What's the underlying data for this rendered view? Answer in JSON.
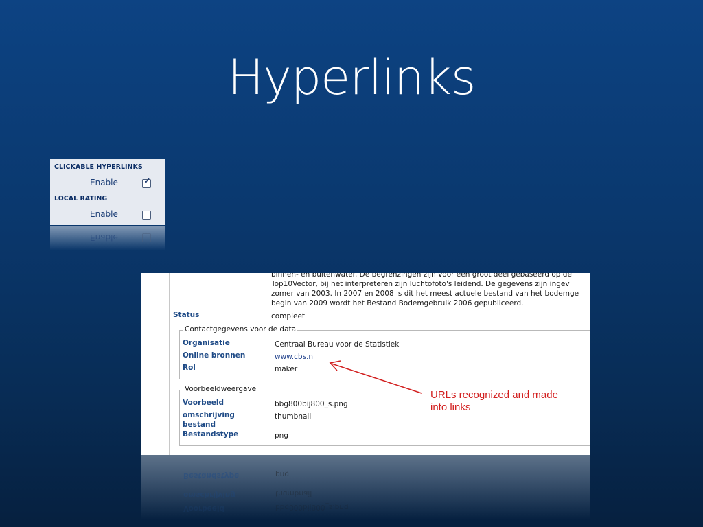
{
  "slide": {
    "title": "Hyperlinks"
  },
  "settings": {
    "clickable_header": "CLICKABLE HYPERLINKS",
    "clickable_enable_label": "Enable",
    "clickable_checked": true,
    "rating_header": "LOCAL RATING",
    "rating_enable_label": "Enable",
    "rating_checked": false
  },
  "data_view": {
    "description_lines": [
      "binnen- en buitenwater. De begrenzingen zijn voor een groot deel gebaseerd op de",
      "Top10Vector, bij het interpreteren zijn luchtofoto's leidend. De gegevens zijn ingev",
      "zomer van 2003. In 2007 en 2008 is dit het meest actuele bestand van het bodemge",
      "begin van 2009 wordt het Bestand Bodemgebruik 2006 gepubliceerd."
    ],
    "status_label": "Status",
    "status_value": "compleet",
    "contact": {
      "legend": "Contactgegevens voor de data",
      "org_label": "Organisatie",
      "org_value": "Centraal Bureau voor de Statistiek",
      "online_label": "Online bronnen",
      "online_value": "www.cbs.nl",
      "rol_label": "Rol",
      "rol_value": "maker"
    },
    "preview": {
      "legend": "Voorbeeldweergave",
      "voorbeeld_label": "Voorbeeld",
      "voorbeeld_value": "bbg800bij800_s.png",
      "omschrijving_label_1": "omschrijving",
      "omschrijving_label_2": "bestand",
      "omschrijving_value": "thumbnail",
      "type_label": "Bestandstype",
      "type_value": "png"
    }
  },
  "annotation": {
    "line1": "URLs recognized and made",
    "line2": "into links",
    "color": "#d21f1f"
  }
}
